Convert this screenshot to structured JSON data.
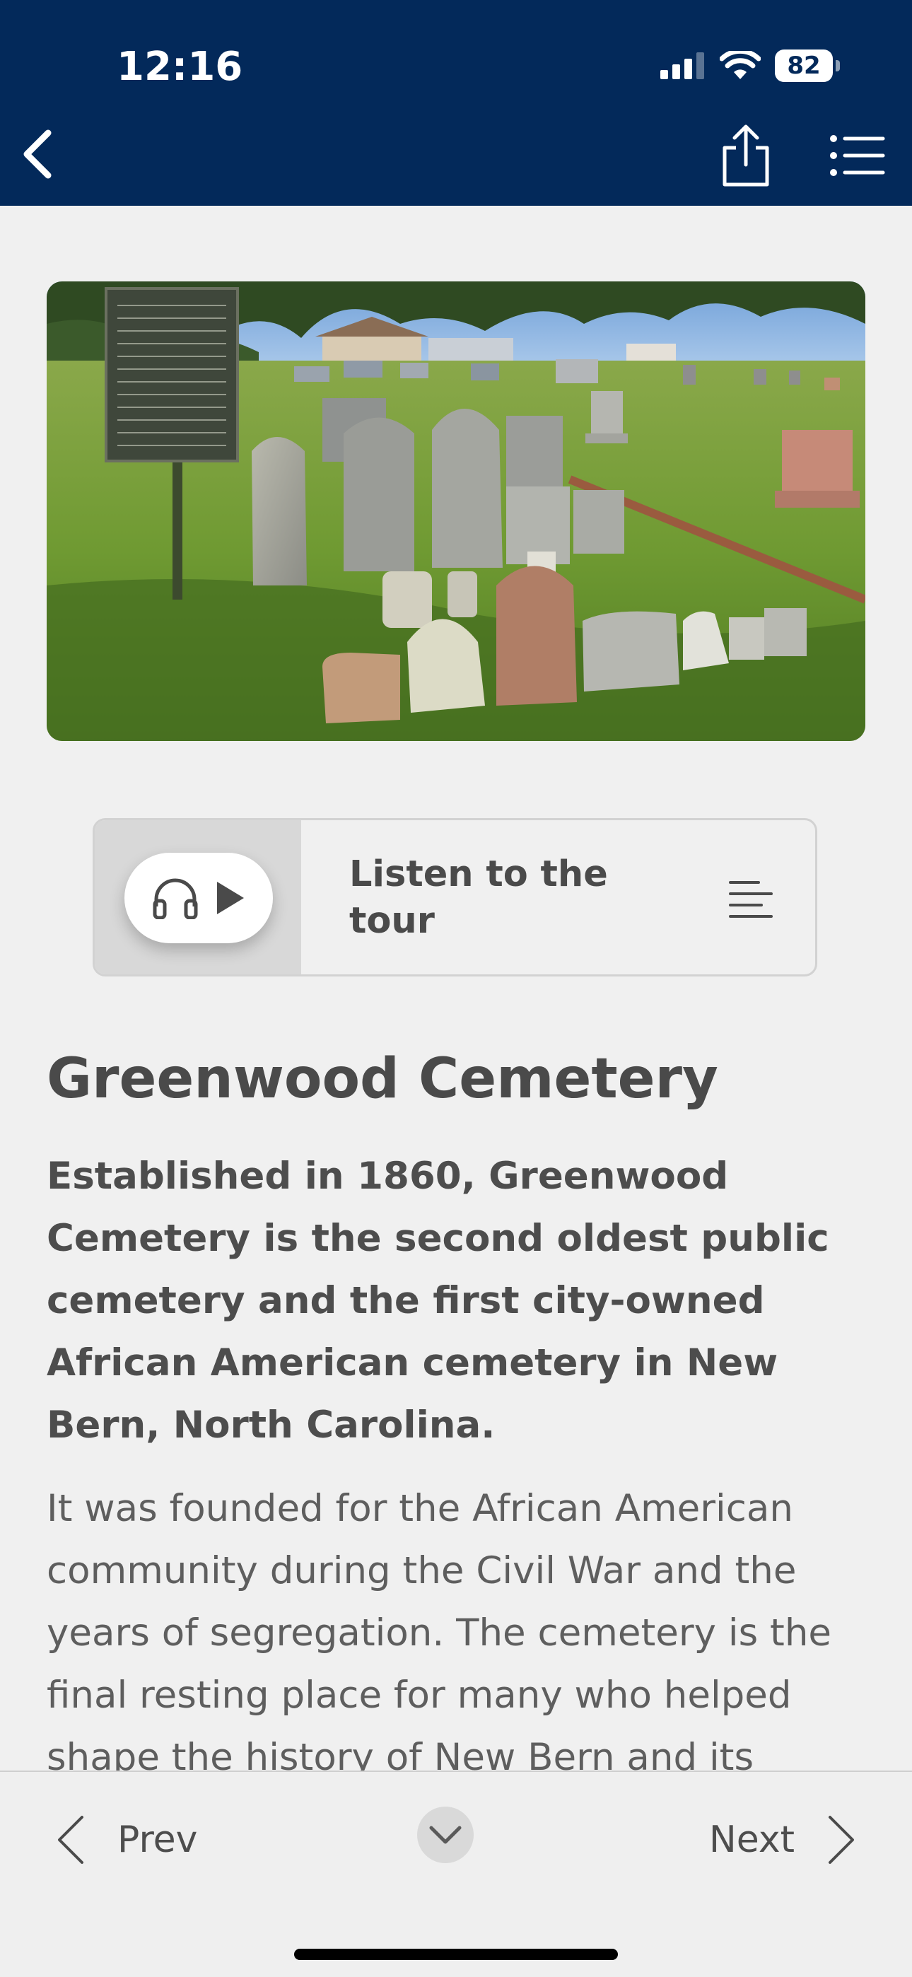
{
  "status_bar": {
    "time": "12:16",
    "battery": "82"
  },
  "toolbar": {
    "back_icon": "chevron-left-icon",
    "share_icon": "share-icon",
    "menu_icon": "list-icon"
  },
  "audio": {
    "label": "Listen to the tour",
    "headphones_icon": "headphones-icon",
    "play_icon": "play-icon",
    "transcript_icon": "text-align-icon"
  },
  "article": {
    "title": "Greenwood Cemetery",
    "lead": "Established in 1860, Greenwood Cemetery is the second oldest public cemetery and the first city-owned African American cemetery in New Bern, North Carolina.",
    "body": "It was founded for the African American community during the Civil War and the years of segregation. The cemetery is the final resting place for many who helped shape the history of New Bern and its"
  },
  "pager": {
    "prev_label": "Prev",
    "next_label": "Next"
  },
  "colors": {
    "navy": "#03295a",
    "background": "#f0f0f0"
  }
}
